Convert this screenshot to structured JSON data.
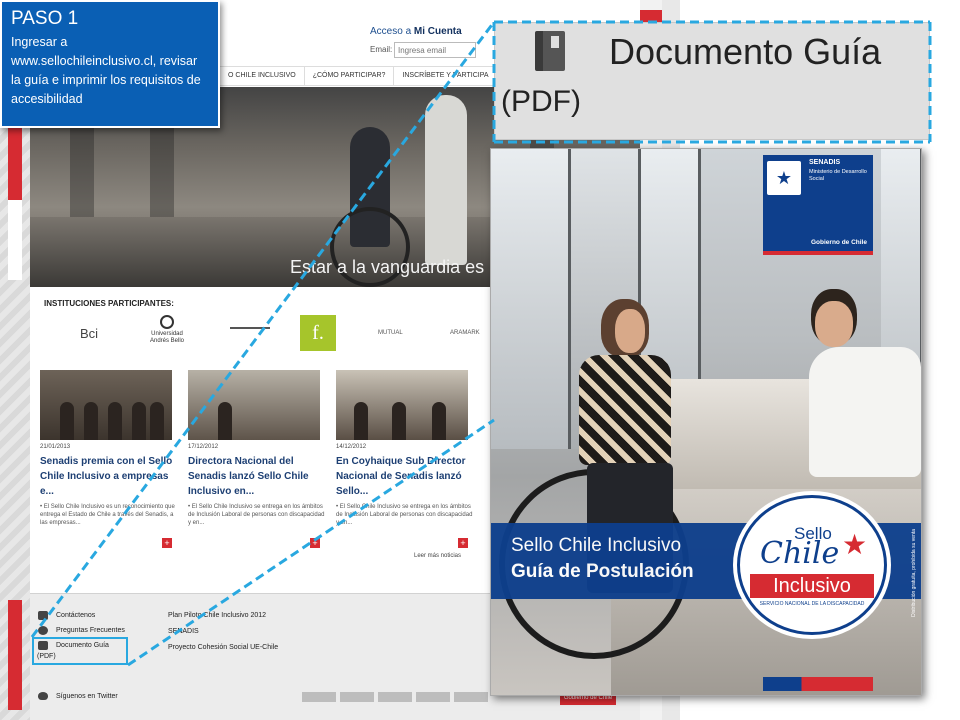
{
  "callout": {
    "title": "PASO 1",
    "text": "Ingresar a www.sellochileinclusivo.cl, revisar la guía e imprimir los requisitos de accesibilidad"
  },
  "site": {
    "acceso_prefix": "Acceso a",
    "acceso_bold": "Mi Cuenta",
    "email_label": "Email:",
    "email_placeholder": "Ingresa email",
    "nav": [
      "O CHILE INCLUSIVO",
      "¿CÓMO PARTICIPAR?",
      "INSCRÍBETE Y PARTICIPA"
    ],
    "hero_text": "Estar a la vanguardia es",
    "institutions_title": "INSTITUCIONES PARTICIPANTES:",
    "logos": {
      "bci": "Bci",
      "universidad": "Universidad Andrés Bello",
      "falabella": "f.",
      "mutual": "MUTUAL",
      "aramark": "ARAMARK"
    },
    "news": [
      {
        "date": "21/01/2013",
        "title": "Senadis premia con el Sello Chile Inclusivo a empresas e...",
        "body": "• El Sello Chile Inclusivo es un reconocimiento que entrega el Estado de Chile a través del Senadis, a las empresas..."
      },
      {
        "date": "17/12/2012",
        "title": "Directora Nacional del Senadis lanzó Sello Chile Inclusivo en...",
        "body": "• El Sello Chile Inclusivo se entrega en los ámbitos de Inclusión Laboral de personas con discapacidad y en..."
      },
      {
        "date": "14/12/2012",
        "title": "En Coyhaique Sub Director Nacional de Senadis lanzó Sello...",
        "body": "• El Sello Chile Inclusivo se entrega en los ámbitos de Inclusión Laboral de personas con discapacidad y en..."
      }
    ],
    "leer_mas": "Leer más noticias",
    "footer": {
      "contact": "Contáctenos",
      "faq": "Preguntas Frecuentes",
      "doc": "Documento Guía",
      "pdf": "(PDF)",
      "twitter": "Síguenos en Twitter",
      "col2": [
        "Plan Piloto Chile Inclusivo 2012",
        "SENADIS",
        "Proyecto Cohesión Social UE-Chile"
      ],
      "gob": "Gobierno de Chile"
    }
  },
  "zoom": {
    "label": "Documento Guía",
    "pdf": "(PDF)"
  },
  "cover": {
    "senadis": "SENADIS",
    "ministerio": "Ministerio de Desarrollo Social",
    "gobierno": "Gobierno de Chile",
    "title1": "Sello Chile Inclusivo",
    "title2": "Guía de Postulación",
    "seal_sello": "Sello",
    "seal_chile": "Chile",
    "seal_inclusivo": "Inclusivo",
    "seal_sub": "SERVICIO NACIONAL DE LA DISCAPACIDAD",
    "side": "Distribución gratuita, prohibida su venta"
  },
  "colors": {
    "callout_blue": "#0a5fb4",
    "senadis_blue": "#0e3f8c",
    "chile_red": "#d62b32",
    "highlight": "#29a8e0"
  }
}
